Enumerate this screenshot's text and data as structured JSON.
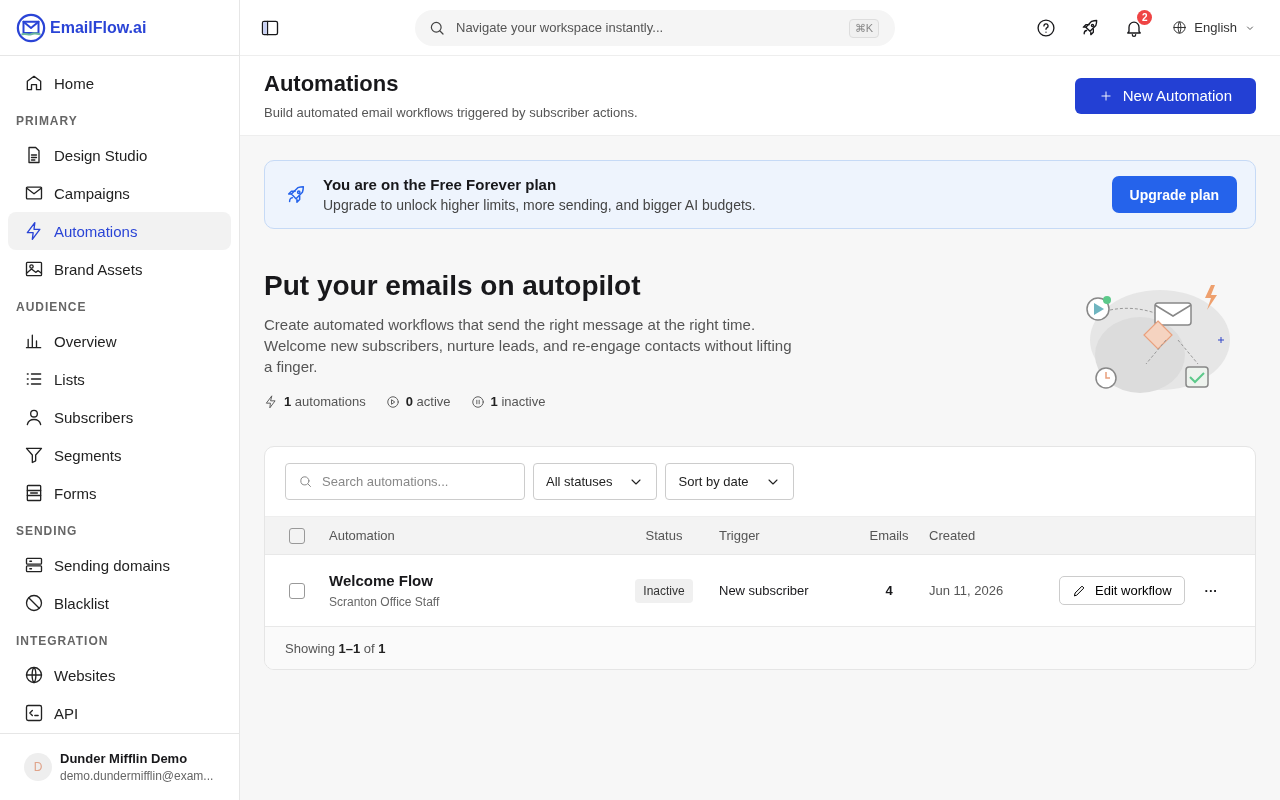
{
  "brand": {
    "name": "EmailFlow.ai"
  },
  "sidebar": {
    "items": [
      {
        "label": "Home",
        "selected": false
      }
    ],
    "sections": [
      {
        "title": "PRIMARY",
        "items": [
          {
            "label": "Design Studio",
            "selected": false
          },
          {
            "label": "Campaigns",
            "selected": false
          },
          {
            "label": "Automations",
            "selected": true
          },
          {
            "label": "Brand Assets",
            "selected": false
          }
        ]
      },
      {
        "title": "AUDIENCE",
        "items": [
          {
            "label": "Overview",
            "selected": false
          },
          {
            "label": "Lists",
            "selected": false
          },
          {
            "label": "Subscribers",
            "selected": false
          },
          {
            "label": "Segments",
            "selected": false
          },
          {
            "label": "Forms",
            "selected": false
          }
        ]
      },
      {
        "title": "SENDING",
        "items": [
          {
            "label": "Sending domains",
            "selected": false
          },
          {
            "label": "Blacklist",
            "selected": false
          }
        ]
      },
      {
        "title": "INTEGRATION",
        "items": [
          {
            "label": "Websites",
            "selected": false
          },
          {
            "label": "API",
            "selected": false
          }
        ]
      }
    ],
    "user": {
      "initial": "D",
      "name": "Dunder Mifflin Demo",
      "email": "demo.dundermifflin@exam..."
    }
  },
  "topbar": {
    "search": {
      "placeholder": "Navigate your workspace instantly...",
      "shortcut": "⌘K"
    },
    "notifications": {
      "count": "2"
    },
    "language": "English"
  },
  "page_header": {
    "title": "Automations",
    "subtitle": "Build automated email workflows triggered by subscriber actions.",
    "button": "New Automation"
  },
  "banner": {
    "title": "You are on the Free Forever plan",
    "text": "Upgrade to unlock higher limits, more sending, and bigger AI budgets.",
    "button": "Upgrade plan"
  },
  "hero": {
    "title": "Put your emails on autopilot",
    "text": "Create automated workflows that send the right message at the right time. Welcome new subscribers, nurture leads, and re-engage contacts without lifting a finger.",
    "stats": [
      {
        "kind": "total",
        "count": "1",
        "label": "automations"
      },
      {
        "kind": "active",
        "count": "0",
        "label": "active"
      },
      {
        "kind": "inactive",
        "count": "1",
        "label": "inactive"
      }
    ]
  },
  "table": {
    "search": {
      "placeholder": "Search automations..."
    },
    "filters": [
      "All statuses",
      "Sort by date"
    ],
    "select_all": {
      "checked": false
    },
    "columns": [
      "Automation",
      "Status",
      "Trigger",
      "Emails",
      "Created"
    ],
    "rows": [
      {
        "checked": false,
        "name": "Welcome Flow",
        "list": "Scranton Office Staff",
        "status": "Inactive",
        "trigger": "New subscriber",
        "emails": "4",
        "created": "Jun 11, 2026",
        "action": "Edit workflow",
        "menu": "···"
      }
    ],
    "footer": "Showing **1–1** of **1**"
  }
}
